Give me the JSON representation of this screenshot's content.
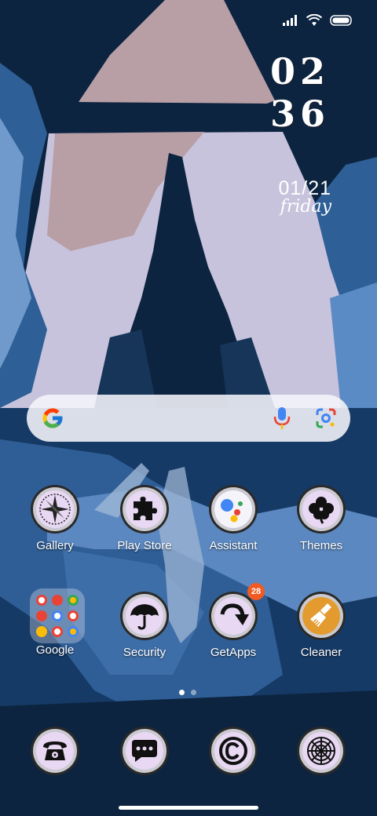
{
  "clock": {
    "hour": "02",
    "minute": "36"
  },
  "date": {
    "month_day": "01/21",
    "weekday": "friday"
  },
  "search": {
    "left_icon": "google-g-icon",
    "mic_icon": "voice-search-icon",
    "lens_icon": "google-lens-icon"
  },
  "apps_row1": [
    {
      "label": "Gallery",
      "icon": "compass-rose-icon"
    },
    {
      "label": "Play Store",
      "icon": "puzzle-piece-icon"
    },
    {
      "label": "Assistant",
      "icon": "google-assistant-icon"
    },
    {
      "label": "Themes",
      "icon": "clover-icon"
    }
  ],
  "apps_row2": [
    {
      "label": "Google",
      "icon": "folder-icon"
    },
    {
      "label": "Security",
      "icon": "umbrella-icon"
    },
    {
      "label": "GetApps",
      "icon": "curved-arrow-icon",
      "badge": "28"
    },
    {
      "label": "Cleaner",
      "icon": "broom-icon"
    }
  ],
  "dock": [
    {
      "icon": "telephone-icon"
    },
    {
      "icon": "message-bubble-icon"
    },
    {
      "icon": "copyright-icon"
    },
    {
      "icon": "web-icon"
    }
  ],
  "colors": {
    "badge": "#f15a22",
    "sky": "#c5c3dc",
    "deep": "#0c2440"
  }
}
